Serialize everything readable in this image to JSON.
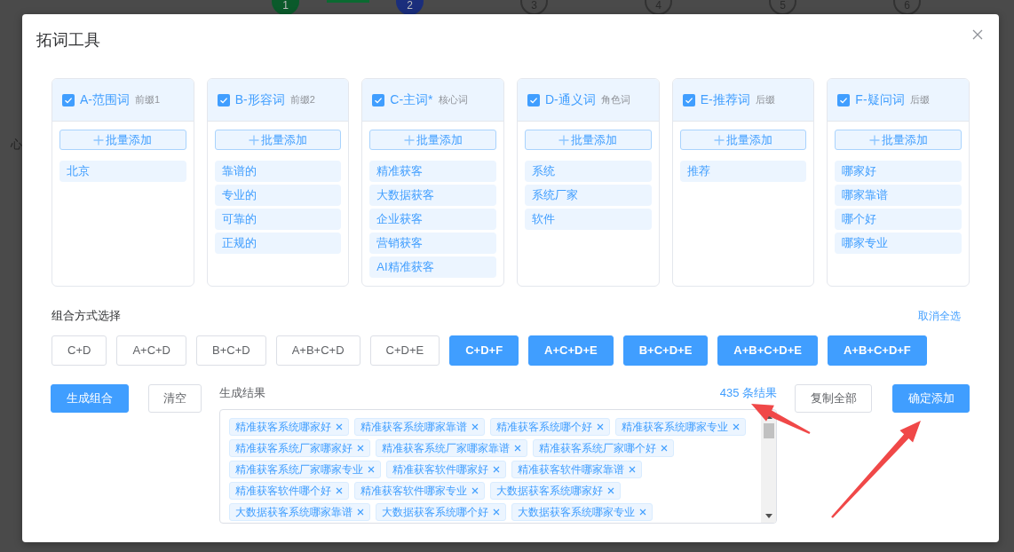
{
  "background_page": {
    "steps": [
      {
        "number": "1",
        "done": true,
        "current": false
      },
      {
        "number": "2",
        "done": false,
        "current": true
      },
      {
        "number": "3",
        "done": false,
        "current": false
      },
      {
        "number": "4",
        "done": false,
        "current": false
      },
      {
        "number": "5",
        "done": false,
        "current": false
      },
      {
        "number": "6",
        "done": false,
        "current": false
      }
    ],
    "left_text": "心"
  },
  "dialog": {
    "title": "拓词工具",
    "word_groups": [
      {
        "title": "A-范围词",
        "note": "前缀1",
        "checked": true,
        "add_button": "批量添加",
        "words": [
          "北京"
        ]
      },
      {
        "title": "B-形容词",
        "note": "前缀2",
        "checked": true,
        "add_button": "批量添加",
        "words": [
          "靠谱的",
          "专业的",
          "可靠的",
          "正规的"
        ]
      },
      {
        "title": "C-主词*",
        "note": "核心词",
        "checked": true,
        "add_button": "批量添加",
        "words": [
          "精准获客",
          "大数据获客",
          "企业获客",
          "营销获客",
          "AI精准获客"
        ]
      },
      {
        "title": "D-通义词",
        "note": "角色词",
        "checked": true,
        "add_button": "批量添加",
        "words": [
          "系统",
          "系统厂家",
          "软件"
        ]
      },
      {
        "title": "E-推荐词",
        "note": "后缀",
        "checked": true,
        "add_button": "批量添加",
        "words": [
          "推荐"
        ]
      },
      {
        "title": "F-疑问词",
        "note": "后缀",
        "checked": true,
        "add_button": "批量添加",
        "words": [
          "哪家好",
          "哪家靠谱",
          "哪个好",
          "哪家专业"
        ]
      }
    ],
    "combination": {
      "label": "组合方式选择",
      "clear_all_link": "取消全选",
      "options": [
        {
          "label": "C+D",
          "selected": false
        },
        {
          "label": "A+C+D",
          "selected": false
        },
        {
          "label": "B+C+D",
          "selected": false
        },
        {
          "label": "A+B+C+D",
          "selected": false
        },
        {
          "label": "C+D+E",
          "selected": false
        },
        {
          "label": "C+D+F",
          "selected": true
        },
        {
          "label": "A+C+D+E",
          "selected": true
        },
        {
          "label": "B+C+D+E",
          "selected": true
        },
        {
          "label": "A+B+C+D+E",
          "selected": true
        },
        {
          "label": "A+B+C+D+F",
          "selected": true
        }
      ]
    },
    "generate_button": "生成组合",
    "clear_button": "清空",
    "results": {
      "label": "生成结果",
      "count": "435 条结果",
      "tags": [
        "精准获客系统哪家好",
        "精准获客系统哪家靠谱",
        "精准获客系统哪个好",
        "精准获客系统哪家专业",
        "精准获客系统厂家哪家好",
        "精准获客系统厂家哪家靠谱",
        "精准获客系统厂家哪个好",
        "精准获客系统厂家哪家专业",
        "精准获客软件哪家好",
        "精准获客软件哪家靠谱",
        "精准获客软件哪个好",
        "精准获客软件哪家专业",
        "大数据获客系统哪家好",
        "大数据获客系统哪家靠谱",
        "大数据获客系统哪个好",
        "大数据获客系统哪家专业"
      ]
    },
    "copy_all_button": "复制全部",
    "confirm_button": "确定添加"
  }
}
